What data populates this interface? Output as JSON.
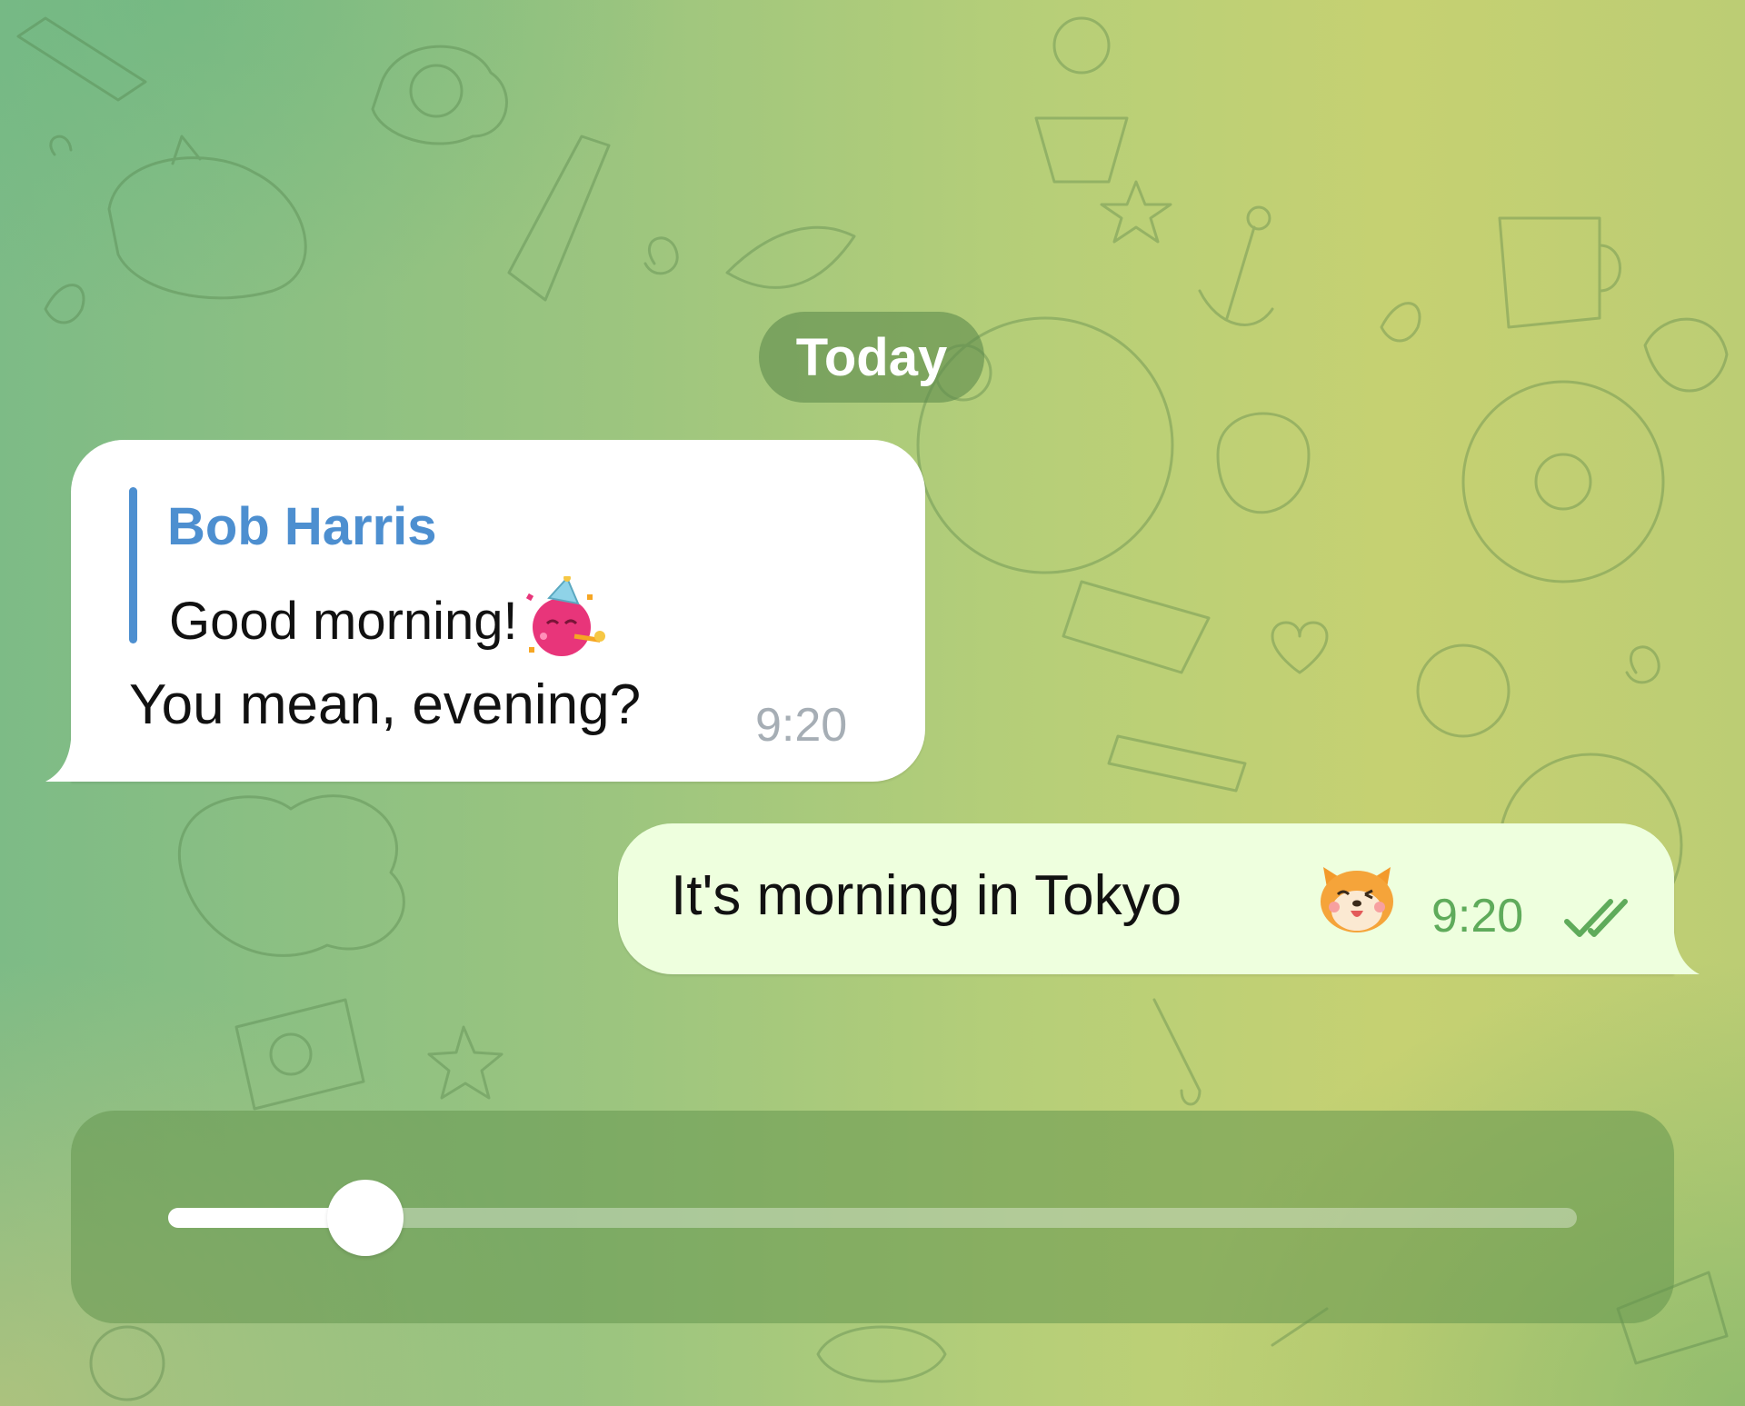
{
  "chat": {
    "date_separator": "Today",
    "messages": [
      {
        "direction": "incoming",
        "reply_to": {
          "author": "Bob Harris",
          "text": "Good morning!",
          "emoji": "party-face-emoji"
        },
        "text": "You mean, evening?",
        "time": "9:20"
      },
      {
        "direction": "outgoing",
        "text": "It's morning in Tokyo",
        "emoji": "shiba-dog-emoji",
        "time": "9:20",
        "status": "read-double-check-icon"
      }
    ]
  },
  "slider": {
    "value_fraction": 0.14
  },
  "colors": {
    "reply_accent": "#4d8fd0",
    "outgoing_bubble": "#eeffde",
    "incoming_bubble": "#ffffff",
    "outgoing_time": "#5fab5b",
    "incoming_time": "#a6aeb5"
  }
}
